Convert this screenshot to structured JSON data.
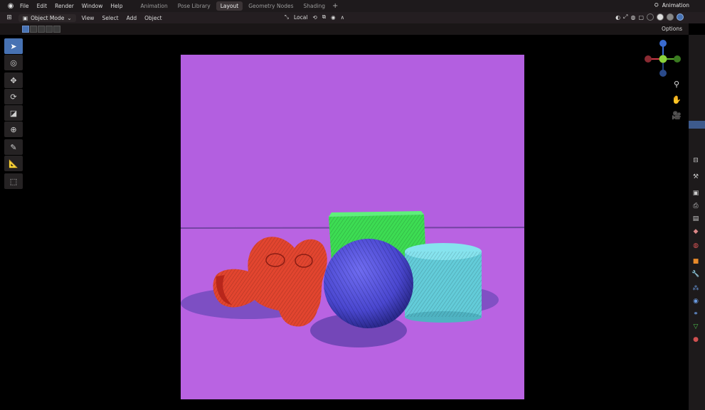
{
  "menubar": {
    "logo_icon": "blender-logo-icon",
    "items": [
      "File",
      "Edit",
      "Render",
      "Window",
      "Help"
    ],
    "workspace_tabs": [
      "Animation",
      "Pose Library",
      "Layout",
      "Geometry Nodes",
      "Shading"
    ],
    "active_tab": "Layout",
    "add_tab": "+",
    "scene_name": "Animation"
  },
  "header": {
    "mode": "Object Mode",
    "menus": [
      "View",
      "Select",
      "Add",
      "Object"
    ],
    "transform_orientation": "Local"
  },
  "subheader": {
    "options_label": "Options"
  },
  "toolbar": {
    "tools": [
      "select-box-icon",
      "cursor-icon",
      "move-icon",
      "rotate-icon",
      "scale-icon",
      "transform-icon",
      "annotate-icon",
      "measure-icon",
      "add-cube-icon"
    ]
  },
  "gizmo": {
    "labels": [
      "Z",
      "Y",
      "X"
    ]
  },
  "colors": {
    "accent": "#4772b3",
    "background": "#b35fe0",
    "monkey": "#e2452f",
    "cube": "#3ddc53",
    "sphere": "#4a47cf",
    "cylinder": "#63ccd9"
  }
}
